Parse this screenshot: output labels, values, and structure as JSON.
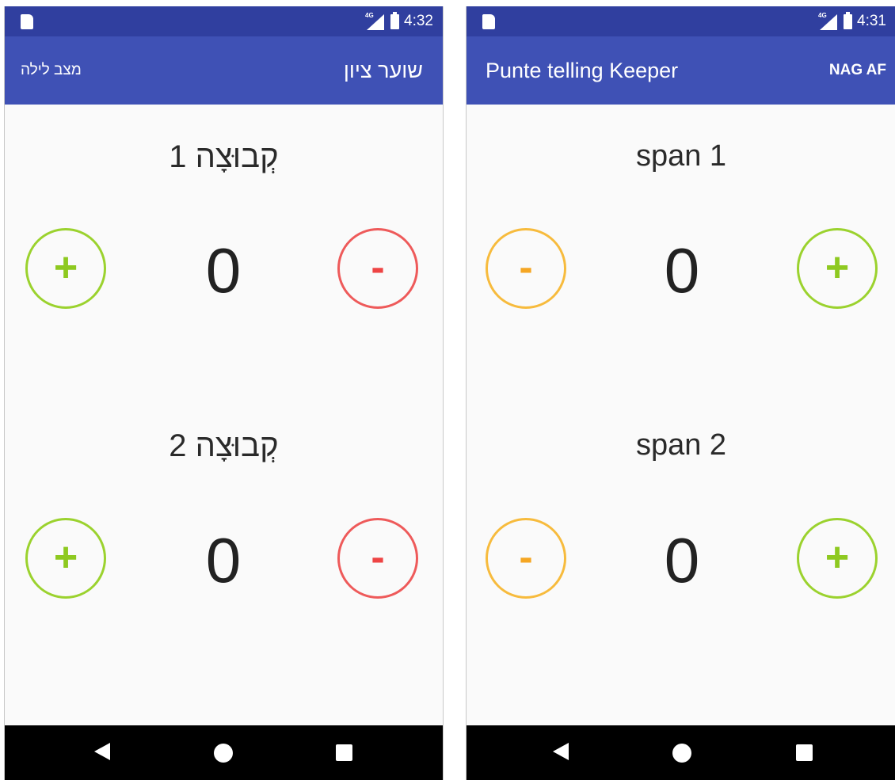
{
  "colors": {
    "status_bar": "#303f9f",
    "app_bar": "#3f51b5",
    "plus": "#8ec920",
    "minus_red": "#ee4444",
    "minus_orange": "#f5a623"
  },
  "left": {
    "status": {
      "time": "4:32",
      "network": "4G"
    },
    "app_title": "שוער ציון",
    "action_label": "מצב לילה",
    "team1": {
      "label": "קְבוּצָה 1",
      "score": "0",
      "plus": "+",
      "minus": "-"
    },
    "team2": {
      "label": "קְבוּצָה 2",
      "score": "0",
      "plus": "+",
      "minus": "-"
    }
  },
  "right": {
    "status": {
      "time": "4:31",
      "network": "4G"
    },
    "app_title": "Punte telling Keeper",
    "action_label": "NAG AF",
    "team1": {
      "label": "span 1",
      "score": "0",
      "plus": "+",
      "minus": "-"
    },
    "team2": {
      "label": "span 2",
      "score": "0",
      "plus": "+",
      "minus": "-"
    }
  },
  "nav": {
    "back": "back-icon",
    "home": "home-icon",
    "recents": "recents-icon"
  }
}
